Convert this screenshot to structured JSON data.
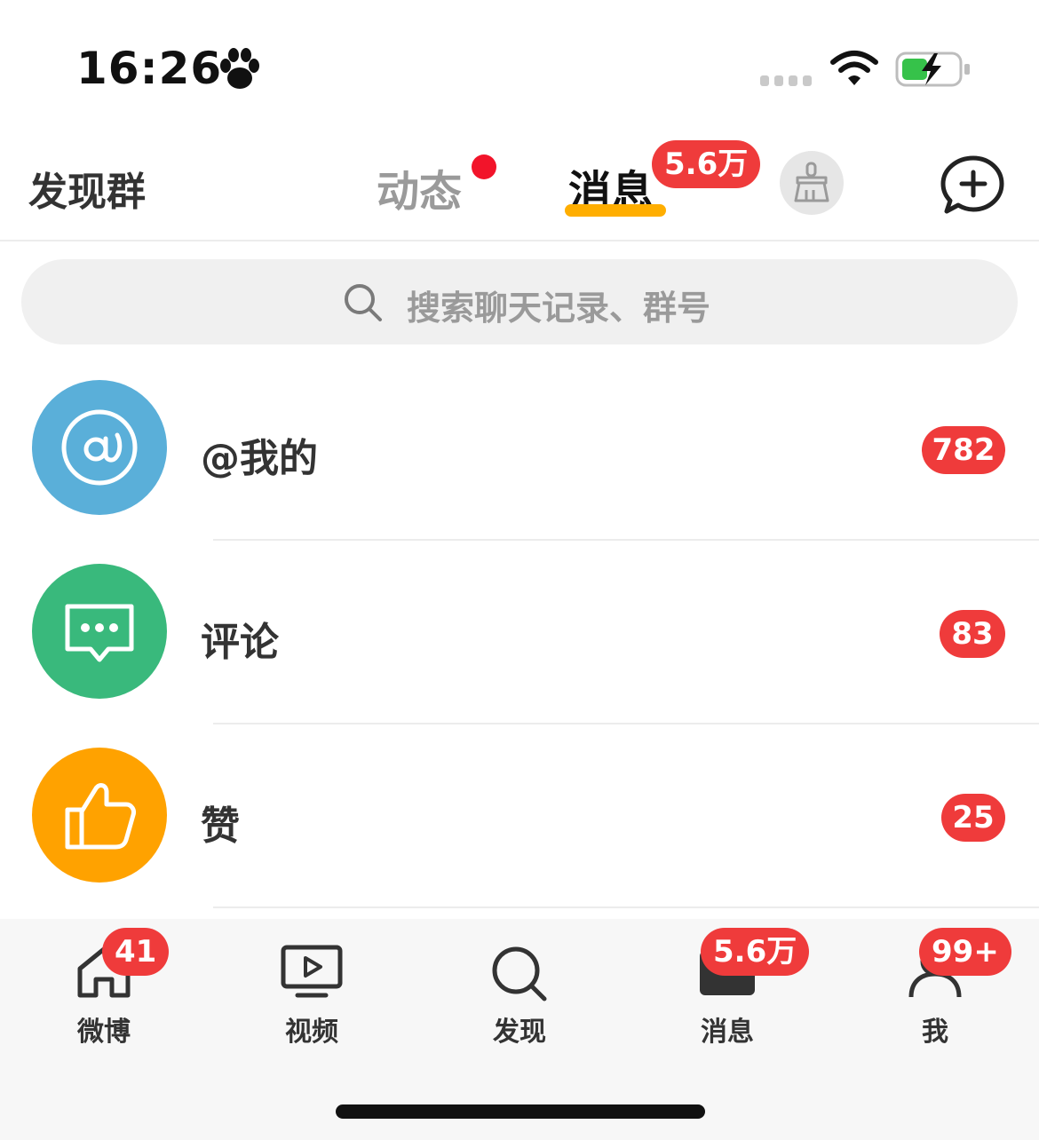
{
  "status_bar": {
    "time": "16:26",
    "icons": [
      "paw-icon",
      "signal-icon",
      "wifi-icon",
      "battery-charging-icon"
    ]
  },
  "header": {
    "left_link": "发现群",
    "tabs": [
      {
        "label": "动态",
        "has_dot": true
      },
      {
        "label": "消息",
        "badge": "5.6万",
        "active": true
      }
    ],
    "icons": [
      "broom-icon",
      "add-chat-icon"
    ],
    "accent_color": "#ffae00",
    "badge_color": "#ef3b3b"
  },
  "search": {
    "placeholder": "搜索聊天记录、群号"
  },
  "messages": [
    {
      "label": "@我的",
      "count": "782",
      "icon": "at-sign-icon",
      "color": "#5aafd9"
    },
    {
      "label": "评论",
      "count": "83",
      "icon": "comment-bubble-icon",
      "color": "#39b97c"
    },
    {
      "label": "赞",
      "count": "25",
      "icon": "thumbs-up-icon",
      "color": "#ffa200"
    }
  ],
  "tab_bar": {
    "items": [
      {
        "label": "微博",
        "badge": "41",
        "icon": "home-icon"
      },
      {
        "label": "视频",
        "icon": "video-icon"
      },
      {
        "label": "发现",
        "icon": "search-icon"
      },
      {
        "label": "消息",
        "badge": "5.6万",
        "icon": "message-icon"
      },
      {
        "label": "我",
        "badge": "99+",
        "icon": "profile-icon"
      }
    ]
  }
}
